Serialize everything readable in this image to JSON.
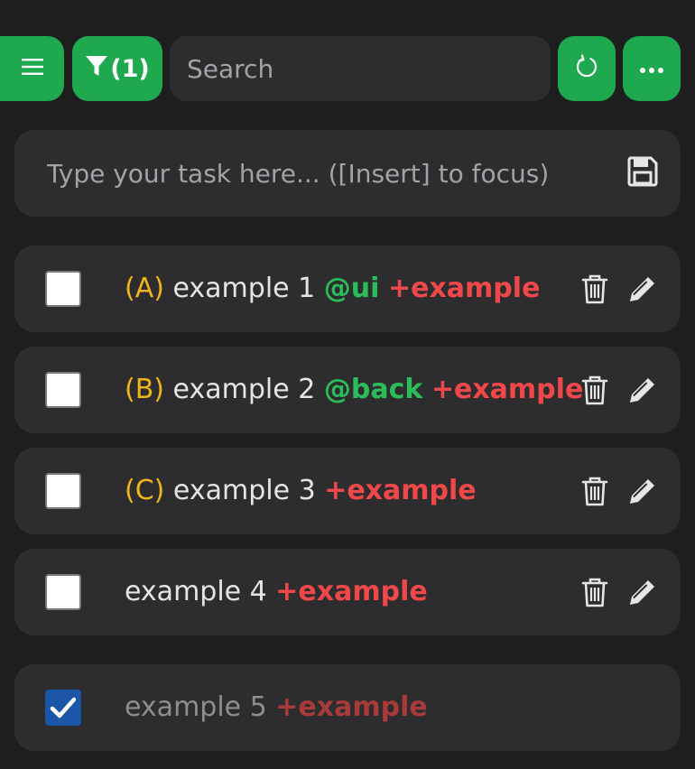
{
  "toolbar": {
    "filter_label": "(1)",
    "search_placeholder": "Search"
  },
  "new_task": {
    "placeholder": "Type your task here... ([Insert] to focus)"
  },
  "colors": {
    "accent": "#1fa94f",
    "priority": "#f0b517",
    "context": "#2bbd5a",
    "project": "#f04848",
    "checkbox_checked": "#1c56a8"
  },
  "icons": [
    "menu-icon",
    "filter-icon",
    "refresh-icon",
    "more-icon",
    "save-icon",
    "trash-icon",
    "pencil-icon",
    "checkmark-icon"
  ],
  "tasks": [
    {
      "priority": "(A)",
      "text": "example 1",
      "context": "@ui",
      "project": "+example",
      "done": false
    },
    {
      "priority": "(B)",
      "text": "example 2",
      "context": "@back",
      "project": "+example",
      "done": false
    },
    {
      "priority": "(C)",
      "text": "example 3",
      "project": "+example",
      "done": false
    },
    {
      "text": "example 4",
      "project": "+example",
      "done": false
    },
    {
      "text": "example 5",
      "project": "+example",
      "done": true
    }
  ]
}
